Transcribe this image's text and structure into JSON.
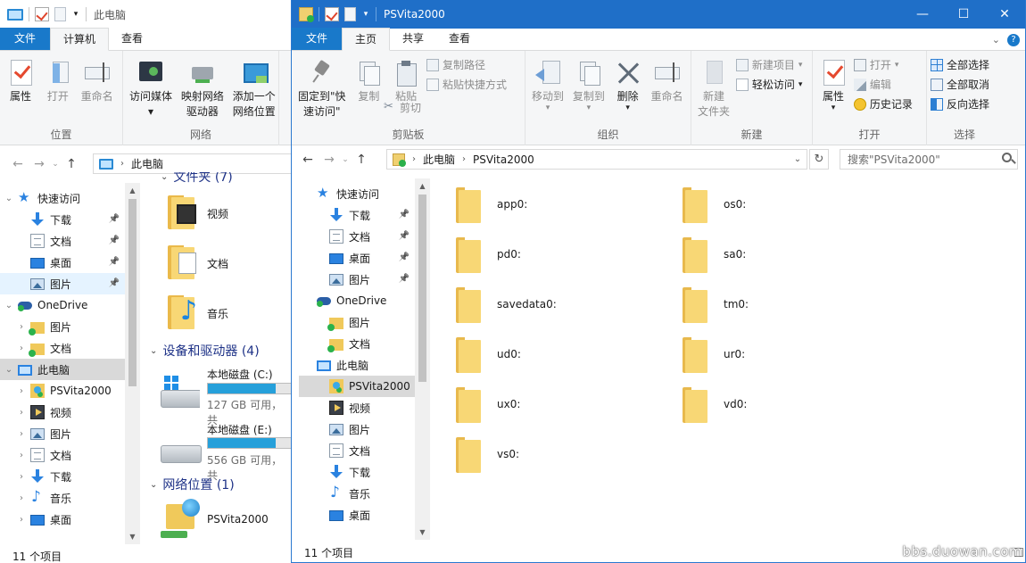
{
  "left_window": {
    "title": "此电脑",
    "tabs": [
      "文件",
      "计算机",
      "查看"
    ],
    "ribbon": {
      "groups": [
        {
          "title": "位置",
          "buttons": [
            "属性",
            "打开",
            "重命名"
          ]
        },
        {
          "title": "网络",
          "buttons": [
            "访问媒体",
            "映射网络\n驱动器",
            "添加一个\n网络位置"
          ]
        }
      ],
      "cut_label": "打"
    },
    "address": "此电脑",
    "nav": [
      {
        "label": "快速访问",
        "icon": "star-icon",
        "indent": 0,
        "chev": "⌄"
      },
      {
        "label": "下载",
        "icon": "download-icon",
        "indent": 1,
        "pin": true
      },
      {
        "label": "文档",
        "icon": "document-icon",
        "indent": 1,
        "pin": true
      },
      {
        "label": "桌面",
        "icon": "desktop-icon",
        "indent": 1,
        "pin": true
      },
      {
        "label": "图片",
        "icon": "picture-icon",
        "indent": 1,
        "pin": true,
        "selected": true
      },
      {
        "label": "OneDrive",
        "icon": "onedrive-icon",
        "indent": 0,
        "chev": "⌄"
      },
      {
        "label": "图片",
        "icon": "folder-sync-icon",
        "indent": 1,
        "chev": "›"
      },
      {
        "label": "文档",
        "icon": "folder-sync-icon",
        "indent": 1,
        "chev": "›"
      },
      {
        "label": "此电脑",
        "icon": "pc-icon",
        "indent": 0,
        "chev": "⌄",
        "highlighted": true
      },
      {
        "label": "PSVita2000",
        "icon": "vita-icon",
        "indent": 1,
        "chev": "›"
      },
      {
        "label": "视频",
        "icon": "video-icon",
        "indent": 1,
        "chev": "›"
      },
      {
        "label": "图片",
        "icon": "picture-icon",
        "indent": 1,
        "chev": "›"
      },
      {
        "label": "文档",
        "icon": "document-icon",
        "indent": 1,
        "chev": "›"
      },
      {
        "label": "下载",
        "icon": "download-icon",
        "indent": 1,
        "chev": "›"
      },
      {
        "label": "音乐",
        "icon": "music-icon",
        "indent": 1,
        "chev": "›"
      },
      {
        "label": "桌面",
        "icon": "desktop-icon",
        "indent": 1,
        "chev": "›"
      }
    ],
    "content": {
      "partial_header": "文件夹 (7)",
      "folders": [
        "视频",
        "文档",
        "音乐"
      ],
      "devices_header": "设备和驱动器 (4)",
      "drives": [
        {
          "name": "本地磁盘 (C:)",
          "info": "127 GB 可用，共",
          "used_fraction": 0.78
        },
        {
          "name": "本地磁盘 (E:)",
          "info": "556 GB 可用，共",
          "used_fraction": 0.78
        }
      ],
      "network_header": "网络位置 (1)",
      "network_items": [
        "PSVita2000"
      ]
    },
    "status": "11 个项目"
  },
  "right_window": {
    "title": "PSVita2000",
    "tabs": [
      "文件",
      "主页",
      "共享",
      "查看"
    ],
    "window_controls": [
      "minimize",
      "maximize",
      "close"
    ],
    "ribbon": {
      "clipboard": {
        "title": "剪贴板",
        "pin_label": "固定到\"快\n速访问\"",
        "copy_label": "复制",
        "paste_label": "粘贴",
        "copy_path": "复制路径",
        "paste_shortcut": "粘贴快捷方式",
        "cut": "剪切"
      },
      "organize": {
        "title": "组织",
        "move_to": "移动到",
        "copy_to": "复制到",
        "delete": "删除",
        "rename": "重命名"
      },
      "new": {
        "title": "新建",
        "new_folder": "新建\n文件夹",
        "new_item": "新建项目",
        "easy_access": "轻松访问"
      },
      "open": {
        "title": "打开",
        "properties": "属性",
        "open": "打开",
        "edit": "编辑",
        "history": "历史记录"
      },
      "select": {
        "title": "选择",
        "select_all": "全部选择",
        "select_none": "全部取消",
        "invert": "反向选择"
      }
    },
    "address": [
      "此电脑",
      "PSVita2000"
    ],
    "search_placeholder": "搜索\"PSVita2000\"",
    "nav": [
      {
        "label": "快速访问",
        "icon": "star-icon",
        "indent": 0
      },
      {
        "label": "下载",
        "icon": "download-icon",
        "indent": 1,
        "pin": true
      },
      {
        "label": "文档",
        "icon": "document-icon",
        "indent": 1,
        "pin": true
      },
      {
        "label": "桌面",
        "icon": "desktop-icon",
        "indent": 1,
        "pin": true
      },
      {
        "label": "图片",
        "icon": "picture-icon",
        "indent": 1,
        "pin": true
      },
      {
        "label": "OneDrive",
        "icon": "onedrive-icon",
        "indent": 0
      },
      {
        "label": "图片",
        "icon": "folder-sync-icon",
        "indent": 1
      },
      {
        "label": "文档",
        "icon": "folder-sync-icon",
        "indent": 1
      },
      {
        "label": "此电脑",
        "icon": "pc-icon",
        "indent": 0
      },
      {
        "label": "PSVita2000",
        "icon": "vita-icon",
        "indent": 1,
        "selected": true
      },
      {
        "label": "视频",
        "icon": "video-icon",
        "indent": 1
      },
      {
        "label": "图片",
        "icon": "picture-icon",
        "indent": 1
      },
      {
        "label": "文档",
        "icon": "document-icon",
        "indent": 1
      },
      {
        "label": "下载",
        "icon": "download-icon",
        "indent": 1
      },
      {
        "label": "音乐",
        "icon": "music-icon",
        "indent": 1
      },
      {
        "label": "桌面",
        "icon": "desktop-icon",
        "indent": 1
      }
    ],
    "folders": [
      "app0:",
      "os0:",
      "pd0:",
      "sa0:",
      "savedata0:",
      "tm0:",
      "ud0:",
      "ur0:",
      "ux0:",
      "vd0:",
      "vs0:"
    ],
    "status": "11 个项目"
  },
  "watermark": "bbs.duowan.com"
}
